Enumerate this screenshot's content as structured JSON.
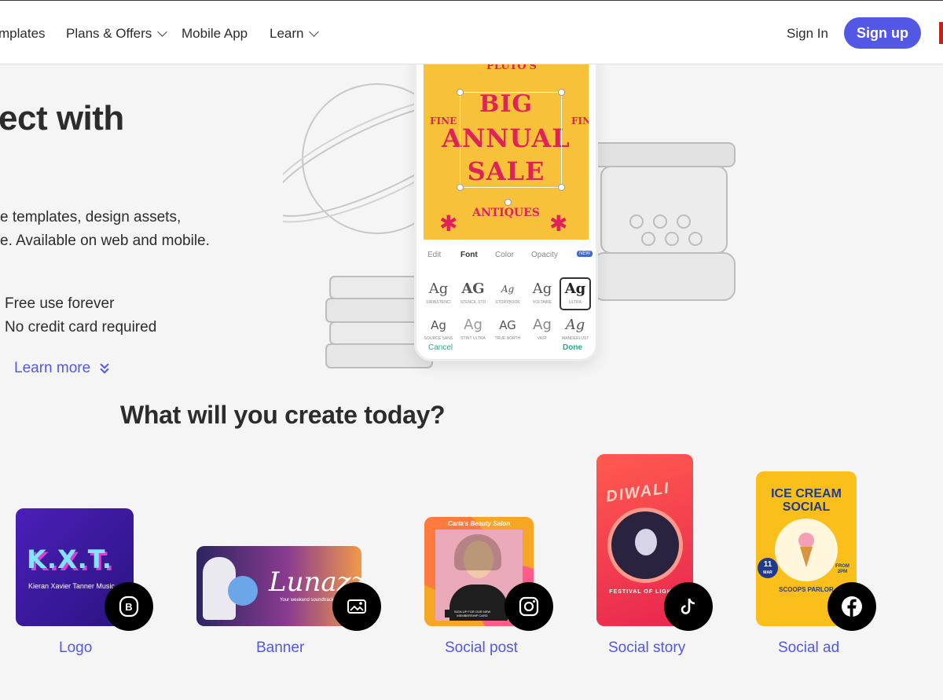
{
  "nav": {
    "items": [
      {
        "label": "mplates",
        "has_dropdown": false
      },
      {
        "label": "Plans & Offers",
        "has_dropdown": true
      },
      {
        "label": "Mobile App",
        "has_dropdown": false
      },
      {
        "label": "Learn",
        "has_dropdown": true
      }
    ],
    "signin_label": "Sign In",
    "signup_label": "Sign up",
    "accent_color": "#5258e4",
    "brand_color": "#eb1000"
  },
  "hero": {
    "title": "ect with",
    "desc_line1": "e templates, design assets,",
    "desc_line2": "e. Available on web and mobile.",
    "features": [
      "Free use forever",
      "No credit card required"
    ],
    "learn_more_label": "Learn more"
  },
  "editor": {
    "poster": {
      "top_text": "PLUTO'S",
      "line1": "BIG",
      "line2": "ANNUAL",
      "line3": "SALE",
      "side_text": "FINE",
      "bottom_text": "ANTIQUES",
      "bg_color": "#f7c23a",
      "text_color": "#e0225a"
    },
    "tabs": [
      {
        "label": "Edit",
        "active": false
      },
      {
        "label": "Font",
        "active": true
      },
      {
        "label": "Color",
        "active": false
      },
      {
        "label": "Opacity",
        "active": false
      }
    ],
    "new_badge": "NEW",
    "fonts": [
      {
        "sample": "Ag",
        "name": "SIRINSTENCI",
        "selected": false
      },
      {
        "sample": "AG",
        "name": "STENCIL STD",
        "selected": false
      },
      {
        "sample": "Ag",
        "name": "STORYBOOK",
        "selected": false
      },
      {
        "sample": "Ag",
        "name": "VOLTAIRE",
        "selected": false
      },
      {
        "sample": "Ag",
        "name": "ULTRA",
        "selected": true
      },
      {
        "sample": "Ag",
        "name": "SOURCE SANS",
        "selected": false
      },
      {
        "sample": "Ag",
        "name": "STINT ULTRA",
        "selected": false
      },
      {
        "sample": "AG",
        "name": "TRUE NORTH",
        "selected": false
      },
      {
        "sample": "Ag",
        "name": "VAST",
        "selected": false
      },
      {
        "sample": "Ag",
        "name": "WANDERLUST",
        "selected": false
      }
    ],
    "cancel_label": "Cancel",
    "done_label": "Done"
  },
  "create": {
    "title": "What will you create today?",
    "cards": [
      {
        "label": "Logo",
        "badge_icon": "logo-b-icon",
        "art_text": "K.X.T.",
        "art_subtext": "Kieran Xavier Tanner Music"
      },
      {
        "label": "Banner",
        "badge_icon": "banner-image-icon",
        "art_text": "Lunazz",
        "art_subtext": "Your weekend soundtrack"
      },
      {
        "label": "Social post",
        "badge_icon": "instagram-icon",
        "art_text": "Carla's Beauty Salon",
        "art_subtext": "SIGN UP FOR OUR NEW MEMBERSHIP CARD"
      },
      {
        "label": "Social story",
        "badge_icon": "tiktok-icon",
        "art_text": "DIWALI",
        "art_subtext": "FESTIVAL OF LIGHTS"
      },
      {
        "label": "Social ad",
        "badge_icon": "facebook-icon",
        "art_text": "ICE CREAM SOCIAL",
        "art_subtext": "SCOOPS PARLOR",
        "art_date_day": "11",
        "art_date_month": "MAR",
        "art_time": "FROM 2PM"
      }
    ]
  }
}
